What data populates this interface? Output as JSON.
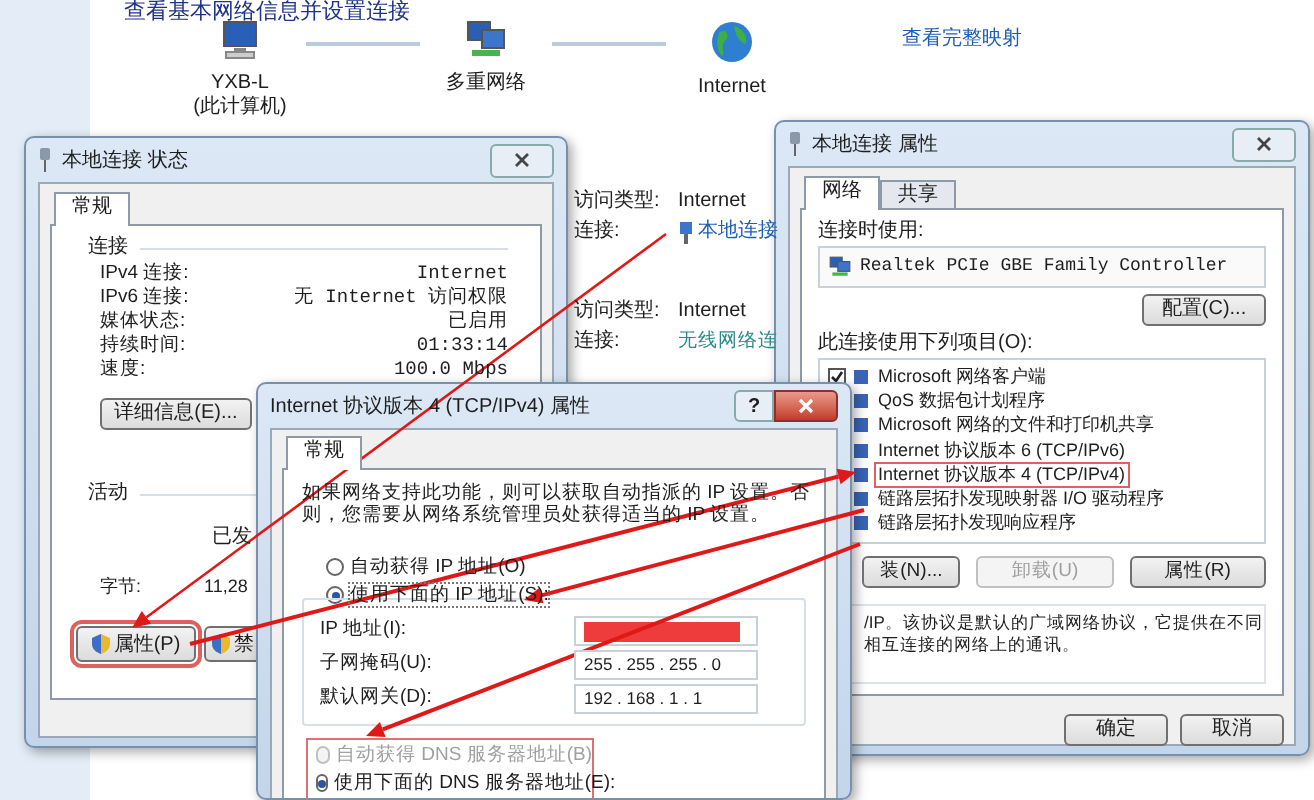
{
  "network_map": {
    "heading": "查看基本网络信息并设置连接",
    "nodes": [
      {
        "kind": "computer",
        "label": "YXB-L",
        "sublabel": "(此计算机)"
      },
      {
        "kind": "network",
        "label": "多重网络"
      },
      {
        "kind": "globe",
        "label": "Internet"
      }
    ],
    "full_map_link": "查看完整映射"
  },
  "connections": [
    {
      "access_label": "访问类型:",
      "access_value": "Internet",
      "conn_label": "连接:",
      "conn_value": "本地连接",
      "icon": true
    },
    {
      "access_label": "访问类型:",
      "access_value": "Internet",
      "conn_label": "连接:",
      "conn_value": "无线网络连",
      "icon": false
    }
  ],
  "status_dialog": {
    "title": "本地连接 状态",
    "tabs": [
      {
        "label": "常规",
        "selected": true
      }
    ],
    "connection_section": "连接",
    "rows": [
      {
        "label": "IPv4 连接:",
        "value": "Internet"
      },
      {
        "label": "IPv6 连接:",
        "value": "无 Internet 访问权限"
      },
      {
        "label": "媒体状态:",
        "value": "已启用"
      },
      {
        "label": "持续时间:",
        "value": "01:33:14"
      },
      {
        "label": "速度:",
        "value": "100.0 Mbps"
      }
    ],
    "details_button": "详细信息(E)...",
    "activity_section": "活动",
    "sent_label": "已发",
    "bytes_label": "字节:",
    "bytes_sent": "11,28",
    "buttons": [
      {
        "label": "属性(P)",
        "highlighted": true
      },
      {
        "label": "禁",
        "highlighted": false
      }
    ]
  },
  "ipv4_dialog": {
    "title": "Internet 协议版本 4 (TCP/IPv4) 属性",
    "help": "?",
    "tabs": [
      {
        "label": "常规",
        "selected": true
      }
    ],
    "intro": "如果网络支持此功能，则可以获取自动指派的 IP 设置。否则，您需要从网络系统管理员处获得适当的 IP 设置。",
    "ip_options": [
      {
        "label": "自动获得 IP 地址(O)",
        "selected": false
      },
      {
        "label": "使用下面的 IP 地址(S):",
        "selected": true
      }
    ],
    "fields": [
      {
        "label": "IP 地址(I):",
        "redacted": true
      },
      {
        "label": "子网掩码(U):",
        "redacted": false,
        "value": "255 . 255 . 255 . 0"
      },
      {
        "label": "默认网关(D):",
        "redacted": false,
        "value": "192 . 168 . 1 . 1"
      }
    ],
    "dns_options": [
      {
        "label": "自动获得 DNS 服务器地址(B)",
        "selected": false,
        "disabled": true
      },
      {
        "label": "使用下面的 DNS 服务器地址(E):",
        "selected": true,
        "disabled": false
      }
    ]
  },
  "properties_dialog": {
    "title": "本地连接 属性",
    "tabs": [
      {
        "label": "网络",
        "selected": true
      },
      {
        "label": "共享",
        "selected": false
      }
    ],
    "connect_using_label": "连接时使用:",
    "adapter": "Realtek PCIe GBE Family Controller",
    "configure_button": "配置(C)...",
    "items_label": "此连接使用下列项目(O):",
    "items": [
      {
        "label": "Microsoft 网络客户端",
        "checked": true,
        "highlighted": false
      },
      {
        "label": "QoS 数据包计划程序",
        "highlighted": false
      },
      {
        "label": "Microsoft 网络的文件和打印机共享",
        "highlighted": false
      },
      {
        "label": "Internet 协议版本 6 (TCP/IPv6)",
        "highlighted": false
      },
      {
        "label": "Internet 协议版本 4 (TCP/IPv4)",
        "highlighted": true
      },
      {
        "label": "链路层拓扑发现映射器 I/O 驱动程序",
        "highlighted": false
      },
      {
        "label": "链路层拓扑发现响应程序",
        "highlighted": false
      }
    ],
    "buttons": [
      {
        "label": "装(N)...",
        "disabled": false
      },
      {
        "label": "卸载(U)",
        "disabled": true
      },
      {
        "label": "属性(R)",
        "disabled": false
      }
    ],
    "description": [
      "/IP。该协议是默认的广域网络协议，它提供在不同",
      "相互连接的网络上的通讯。"
    ],
    "footer_buttons": [
      "确定",
      "取消"
    ]
  }
}
